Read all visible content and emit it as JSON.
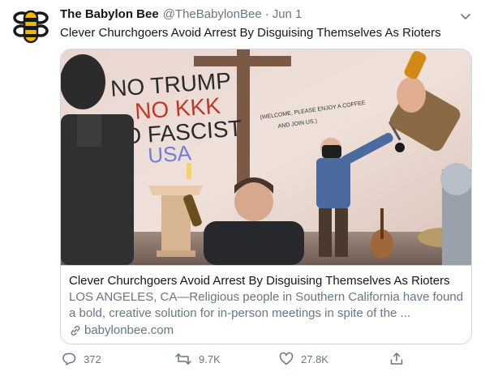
{
  "tweet": {
    "display_name": "The Babylon Bee",
    "handle": "@TheBabylonBee",
    "separator": "·",
    "date": "Jun 1",
    "text": "Clever Churchgoers Avoid Arrest By Disguising Themselves As Rioters"
  },
  "card": {
    "image_wall_text": {
      "line1": "NO TRUMP",
      "line2": "NO KKK",
      "line3": "NO FASCIST",
      "line4": "USA",
      "welcome1": "(WELCOME, PLEASE ENJOY A COFFEE",
      "welcome2": "AND JOIN US.)"
    },
    "title": "Clever Churchgoers Avoid Arrest By Disguising Themselves As Rioters",
    "description_line1": "LOS ANGELES, CA—Religious people in Southern California have found",
    "description_line2": "a bold, creative solution for in-person meetings in spite of the ...",
    "domain": "babylonbee.com"
  },
  "actions": {
    "reply_count": "372",
    "retweet_count": "9.7K",
    "like_count": "27.8K"
  },
  "colors": {
    "text_primary": "#14171a",
    "text_secondary": "#657786",
    "border": "#ccd6dd",
    "wall_red": "#c0392b",
    "wall_blue": "#6f7fd6"
  },
  "icons": {
    "avatar": "bee-logo-icon",
    "menu": "chevron-down-icon",
    "link": "link-icon",
    "reply": "reply-icon",
    "retweet": "retweet-icon",
    "like": "heart-icon",
    "share": "share-icon"
  }
}
